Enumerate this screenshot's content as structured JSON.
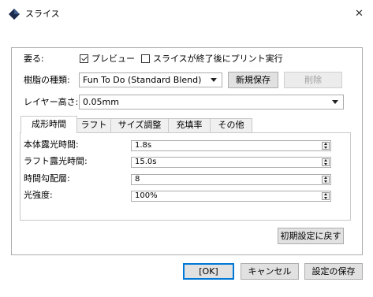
{
  "window": {
    "title": "スライス",
    "close_glyph": "✕"
  },
  "colors": {
    "panel_border": "#adadad",
    "button_face": "#e1e1e1",
    "default_button_border": "#0078d7"
  },
  "row1": {
    "label": "要る:",
    "preview_label": "プレビュー",
    "preview_checked": true,
    "auto_print_label": "スライスが終了後にプリント実行",
    "auto_print_checked": false
  },
  "row2": {
    "label": "樹脂の種類:",
    "resin_value": "Fun To Do (Standard Blend)",
    "new_save_label": "新規保存",
    "delete_label": "削除"
  },
  "row3": {
    "label": "レイヤー高さ:",
    "layer_value": "0.05mm"
  },
  "tabs": [
    {
      "label": "成形時間",
      "active": true
    },
    {
      "label": "ラフト",
      "active": false
    },
    {
      "label": "サイズ調整",
      "active": false
    },
    {
      "label": "充填率",
      "active": false
    },
    {
      "label": "その他",
      "active": false
    }
  ],
  "fields": [
    {
      "label": "本体露光時間:",
      "value": "1.8s"
    },
    {
      "label": "ラフト露光時間:",
      "value": "15.0s"
    },
    {
      "label": "時間勾配層:",
      "value": "8"
    },
    {
      "label": "光強度:",
      "value": "100%"
    }
  ],
  "reset_label": "初期設定に戻す",
  "bottom": {
    "ok_label": "[OK]",
    "cancel_label": "キャンセル",
    "save_label": "設定の保存"
  }
}
